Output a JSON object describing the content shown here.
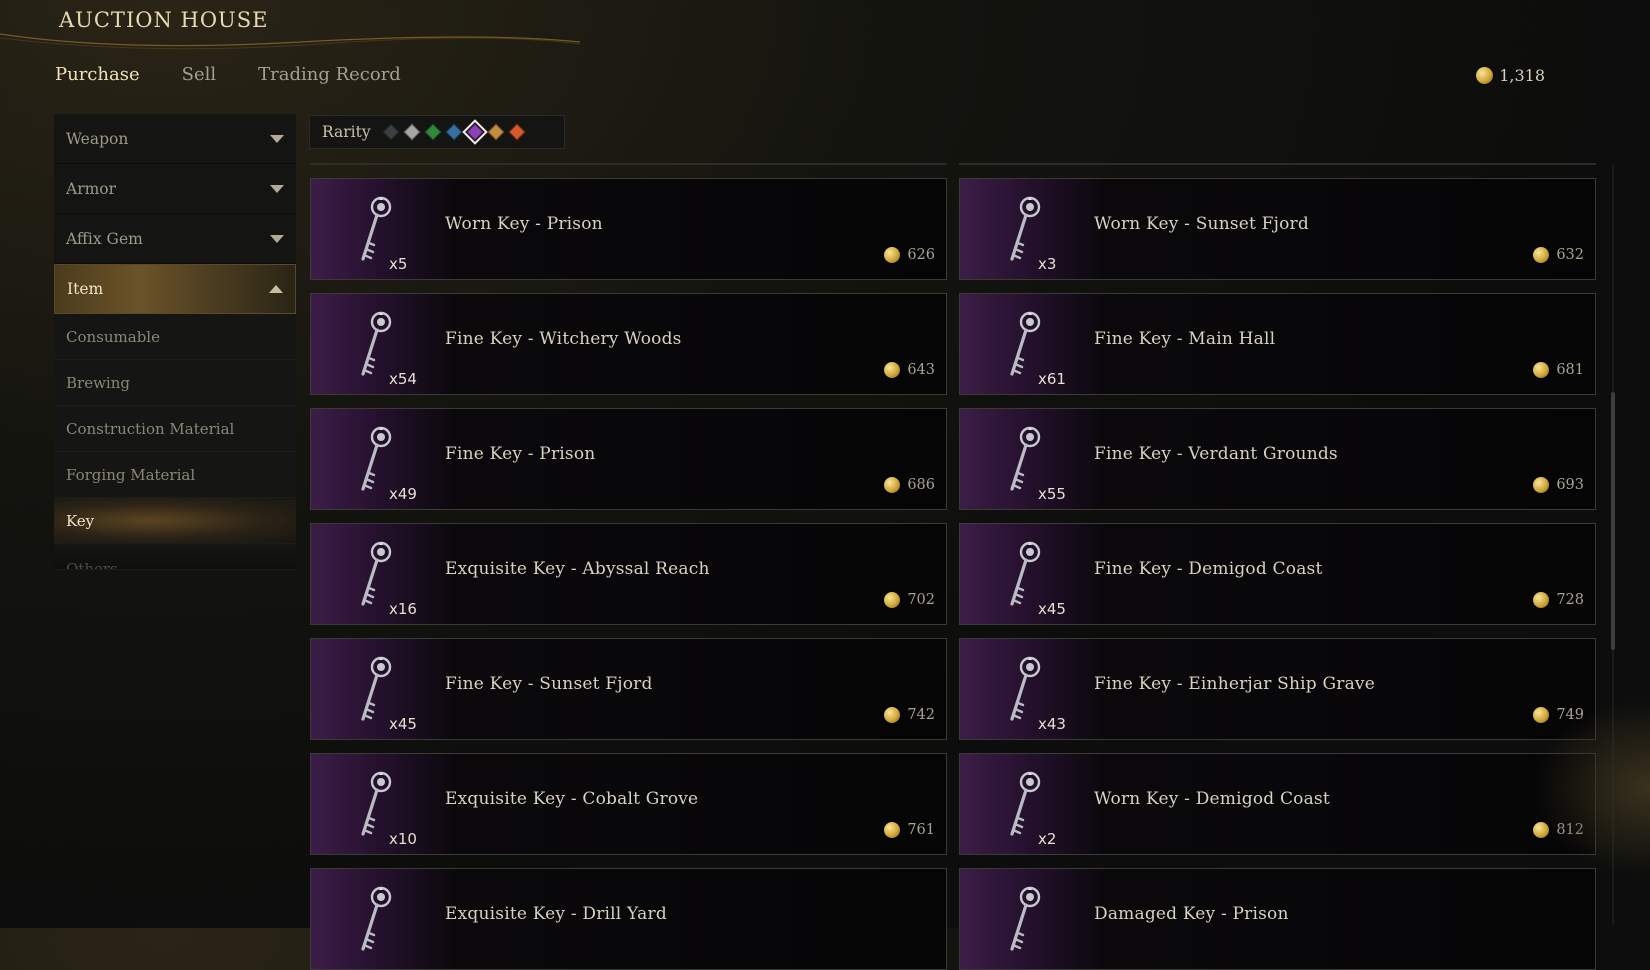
{
  "header": {
    "title": "AUCTION HOUSE",
    "tabs": [
      {
        "label": "Purchase",
        "active": true
      },
      {
        "label": "Sell",
        "active": false
      },
      {
        "label": "Trading Record",
        "active": false
      }
    ],
    "currency": "1,318"
  },
  "sidebar": {
    "categories": [
      {
        "label": "Weapon",
        "expanded": false
      },
      {
        "label": "Armor",
        "expanded": false
      },
      {
        "label": "Affix Gem",
        "expanded": false
      },
      {
        "label": "Item",
        "expanded": true
      }
    ],
    "subcategories": [
      {
        "label": "Consumable"
      },
      {
        "label": "Brewing"
      },
      {
        "label": "Construction Material"
      },
      {
        "label": "Forging Material"
      },
      {
        "label": "Key",
        "selected": true
      },
      {
        "label": "Others"
      }
    ]
  },
  "filter": {
    "label": "Rarity",
    "colors": [
      "#3c3f41",
      "#a7a7a1",
      "#2e8a3a",
      "#356f9e",
      "#8e3fb6",
      "#c28d3c",
      "#d8592a"
    ],
    "selected_index": 4
  },
  "listings": [
    {
      "name": "Worn Key - Prison",
      "qty": "x5",
      "price": "626"
    },
    {
      "name": "Worn Key - Sunset Fjord",
      "qty": "x3",
      "price": "632"
    },
    {
      "name": "Fine Key - Witchery Woods",
      "qty": "x54",
      "price": "643"
    },
    {
      "name": "Fine Key - Main Hall",
      "qty": "x61",
      "price": "681"
    },
    {
      "name": "Fine Key - Prison",
      "qty": "x49",
      "price": "686"
    },
    {
      "name": "Fine Key - Verdant Grounds",
      "qty": "x55",
      "price": "693"
    },
    {
      "name": "Exquisite Key - Abyssal Reach",
      "qty": "x16",
      "price": "702"
    },
    {
      "name": "Fine Key - Demigod Coast",
      "qty": "x45",
      "price": "728"
    },
    {
      "name": "Fine Key - Sunset Fjord",
      "qty": "x45",
      "price": "742"
    },
    {
      "name": "Fine Key - Einherjar Ship Grave",
      "qty": "x43",
      "price": "749"
    },
    {
      "name": "Exquisite Key - Cobalt Grove",
      "qty": "x10",
      "price": "761"
    },
    {
      "name": "Worn Key - Demigod Coast",
      "qty": "x2",
      "price": "812"
    },
    {
      "name": "Exquisite Key - Drill Yard",
      "qty": "",
      "price": ""
    },
    {
      "name": "Damaged Key - Prison",
      "qty": "",
      "price": ""
    }
  ]
}
